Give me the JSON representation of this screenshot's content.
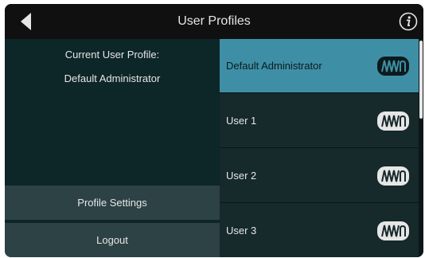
{
  "header": {
    "title": "User Profiles",
    "back_icon": "back-arrow-icon",
    "info_icon": "info-icon"
  },
  "current_profile": {
    "label": "Current User Profile:",
    "value": "Default Administrator"
  },
  "actions": {
    "profile_settings": "Profile Settings",
    "logout": "Logout"
  },
  "profiles": [
    {
      "name": "Default Administrator",
      "selected": true,
      "icon": "presonus-logo-icon"
    },
    {
      "name": "User 1",
      "selected": false,
      "icon": "presonus-logo-icon"
    },
    {
      "name": "User 2",
      "selected": false,
      "icon": "presonus-logo-icon"
    },
    {
      "name": "User 3",
      "selected": false,
      "icon": "presonus-logo-icon"
    }
  ],
  "colors": {
    "selected_row": "#3e8fa6",
    "left_panel": "#0d2628",
    "button_bg": "#2d4245",
    "header_bg": "#101010"
  }
}
